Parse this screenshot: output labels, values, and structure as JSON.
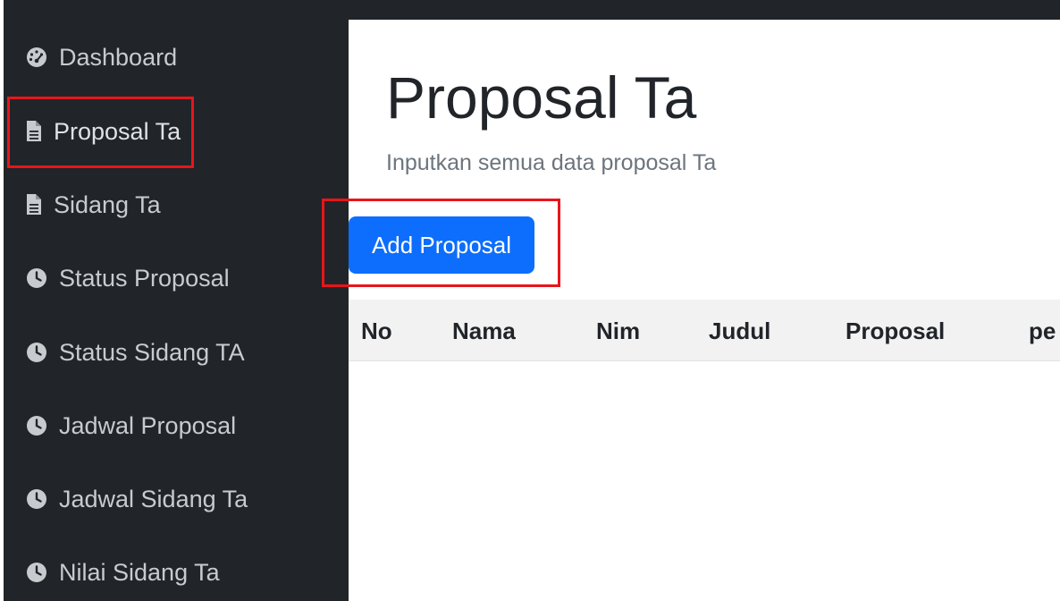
{
  "sidebar": {
    "items": [
      {
        "label": "Dashboard",
        "icon": "dashboard-icon"
      },
      {
        "label": "Proposal Ta",
        "icon": "document-icon"
      },
      {
        "label": "Sidang Ta",
        "icon": "document-icon"
      },
      {
        "label": "Status Proposal",
        "icon": "clock-icon"
      },
      {
        "label": "Status Sidang TA",
        "icon": "clock-icon"
      },
      {
        "label": "Jadwal Proposal",
        "icon": "clock-icon"
      },
      {
        "label": "Jadwal Sidang Ta",
        "icon": "clock-icon"
      },
      {
        "label": "Nilai Sidang Ta",
        "icon": "clock-icon"
      }
    ]
  },
  "main": {
    "title": "Proposal Ta",
    "subtitle": "Inputkan semua data proposal Ta",
    "add_button_label": "Add Proposal",
    "table": {
      "columns": [
        "No",
        "Nama",
        "Nim",
        "Judul",
        "Proposal",
        "pe"
      ],
      "rows": []
    }
  },
  "colors": {
    "sidebar_bg": "#212529",
    "primary_button": "#0d6efd",
    "highlight_box": "#e8151b",
    "table_header_bg": "#f2f2f2"
  }
}
